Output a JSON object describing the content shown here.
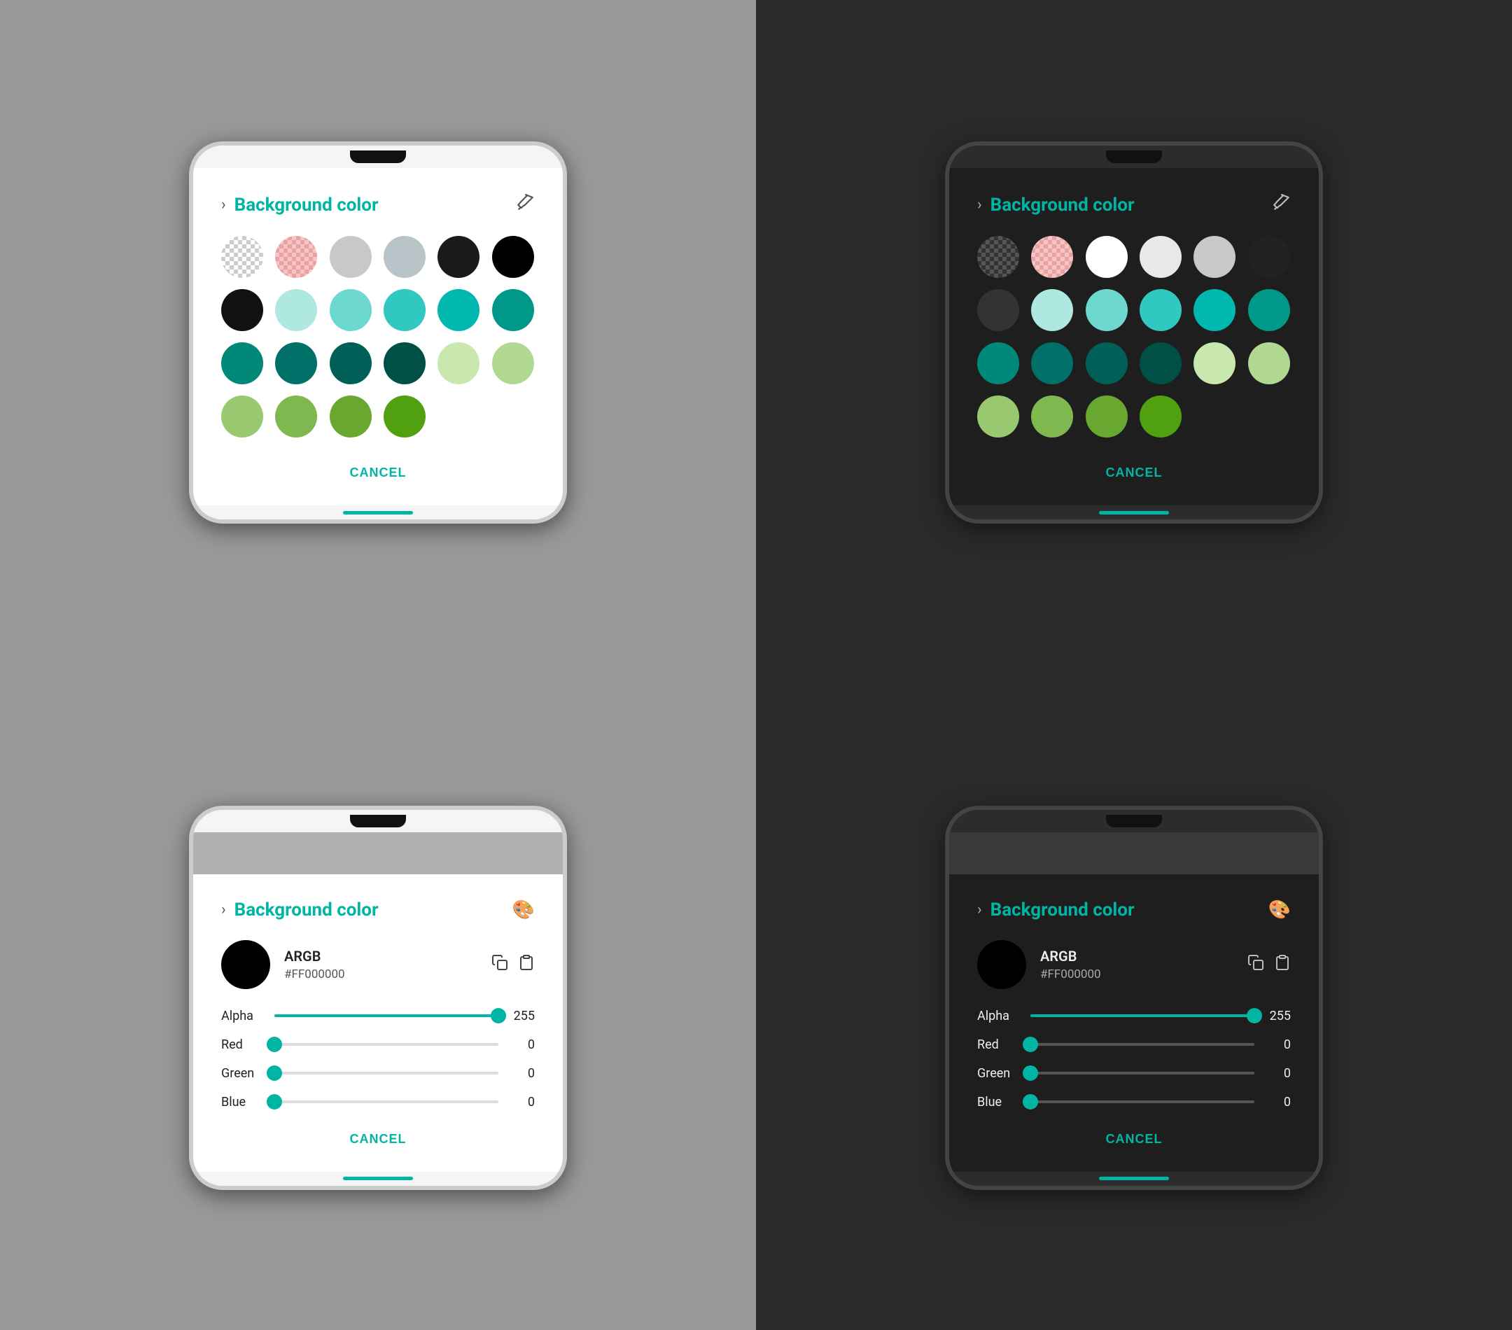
{
  "panels": {
    "top_left": {
      "theme": "light",
      "title": "Background color",
      "mode": "swatches",
      "header_icon": "eyedropper",
      "cancel_label": "CANCEL",
      "swatches": [
        {
          "color": "checkerboard",
          "label": "transparent"
        },
        {
          "color": "pink-check",
          "label": "pink-transparent"
        },
        {
          "color": "#d0d0d0",
          "label": "light-gray"
        },
        {
          "color": "#c0c8cc",
          "label": "light-blue-gray"
        },
        {
          "color": "#1a1a1a",
          "label": "near-black"
        },
        {
          "color": "#000000",
          "label": "black"
        },
        {
          "color": "#111111",
          "label": "black2"
        },
        {
          "color": "#aee8e0",
          "label": "light-teal1"
        },
        {
          "color": "#80d8d0",
          "label": "light-teal2"
        },
        {
          "color": "#40c8c0",
          "label": "teal-mid"
        },
        {
          "color": "#00b8b0",
          "label": "teal"
        },
        {
          "color": "#00a898",
          "label": "teal2"
        },
        {
          "color": "#009888",
          "label": "dark-teal1"
        },
        {
          "color": "#008878",
          "label": "dark-teal2"
        },
        {
          "color": "#007868",
          "label": "dark-teal3"
        },
        {
          "color": "#006858",
          "label": "dark-teal4"
        },
        {
          "color": "#c8e8b0",
          "label": "light-green1"
        },
        {
          "color": "#b0d890",
          "label": "light-green2"
        },
        {
          "color": "#98c870",
          "label": "light-green3"
        },
        {
          "color": "#80b850",
          "label": "green-mid"
        },
        {
          "color": "#68a830",
          "label": "green"
        },
        {
          "color": "#50a010",
          "label": "bright-green"
        }
      ]
    },
    "top_right": {
      "theme": "dark",
      "title": "Background color",
      "mode": "swatches",
      "header_icon": "eyedropper",
      "cancel_label": "CANCEL",
      "swatches": [
        {
          "color": "checkerboard-dark",
          "label": "transparent"
        },
        {
          "color": "pink-check",
          "label": "pink-transparent"
        },
        {
          "color": "#ffffff",
          "label": "white"
        },
        {
          "color": "#e8e8e8",
          "label": "near-white"
        },
        {
          "color": "#d0d0d0",
          "label": "light-gray"
        },
        {
          "color": "#222222",
          "label": "near-black"
        },
        {
          "color": "#333333",
          "label": "dark-gray"
        },
        {
          "color": "#aee8e0",
          "label": "light-teal1"
        },
        {
          "color": "#80d8d0",
          "label": "light-teal2"
        },
        {
          "color": "#40c8c0",
          "label": "teal-mid"
        },
        {
          "color": "#00b8b0",
          "label": "teal"
        },
        {
          "color": "#00a898",
          "label": "teal2"
        },
        {
          "color": "#009888",
          "label": "dark-teal1"
        },
        {
          "color": "#008878",
          "label": "dark-teal2"
        },
        {
          "color": "#007868",
          "label": "dark-teal3"
        },
        {
          "color": "#006858",
          "label": "dark-teal4"
        },
        {
          "color": "#c8e8b0",
          "label": "light-green1"
        },
        {
          "color": "#b0d890",
          "label": "light-green2"
        },
        {
          "color": "#98c870",
          "label": "light-green3"
        },
        {
          "color": "#80b850",
          "label": "green-mid"
        },
        {
          "color": "#68a830",
          "label": "green"
        },
        {
          "color": "#50a010",
          "label": "bright-green"
        }
      ]
    },
    "bottom_left": {
      "theme": "light",
      "title": "Background color",
      "mode": "argb",
      "header_icon": "palette",
      "cancel_label": "CANCEL",
      "color_preview": "#000000",
      "argb_label": "ARGB",
      "argb_value": "#FF000000",
      "sliders": [
        {
          "label": "Alpha",
          "value": 255,
          "percent": 100
        },
        {
          "label": "Red",
          "value": 0,
          "percent": 0
        },
        {
          "label": "Green",
          "value": 0,
          "percent": 0
        },
        {
          "label": "Blue",
          "value": 0,
          "percent": 0
        }
      ]
    },
    "bottom_right": {
      "theme": "dark",
      "title": "Background color",
      "mode": "argb",
      "header_icon": "palette",
      "cancel_label": "CANCEL",
      "color_preview": "#000000",
      "argb_label": "ARGB",
      "argb_value": "#FF000000",
      "sliders": [
        {
          "label": "Alpha",
          "value": 255,
          "percent": 100
        },
        {
          "label": "Red",
          "value": 0,
          "percent": 0
        },
        {
          "label": "Green",
          "value": 0,
          "percent": 0
        },
        {
          "label": "Blue",
          "value": 0,
          "percent": 0
        }
      ]
    }
  },
  "icons": {
    "chevron": "›",
    "eyedropper": "✒",
    "palette": "🎨",
    "copy": "⧉",
    "paste": "📋"
  }
}
